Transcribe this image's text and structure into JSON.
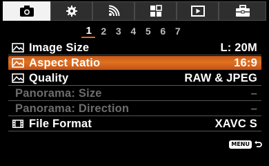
{
  "tabs": [
    {
      "icon": "camera-icon",
      "active": true
    },
    {
      "icon": "gear-icon",
      "active": false
    },
    {
      "icon": "wireless-icon",
      "active": false
    },
    {
      "icon": "grid-icon",
      "active": false
    },
    {
      "icon": "playback-icon",
      "active": false
    },
    {
      "icon": "toolbox-icon",
      "active": false
    }
  ],
  "pages": [
    "1",
    "2",
    "3",
    "4",
    "5",
    "6",
    "7"
  ],
  "active_page": "1",
  "menu_items": [
    {
      "label": "Image Size",
      "value": "L: 20M",
      "icon": "image-icon"
    },
    {
      "label": "Aspect Ratio",
      "value": "16:9",
      "icon": "image-icon",
      "selected": true
    },
    {
      "label": "Quality",
      "value": "RAW & JPEG",
      "icon": "image-icon"
    },
    {
      "label": "Panorama: Size",
      "value": "–",
      "disabled": true
    },
    {
      "label": "Panorama: Direction",
      "value": "–",
      "disabled": true
    },
    {
      "label": "File Format",
      "value": "XAVC S",
      "icon": "film-icon"
    }
  ],
  "footer": {
    "menu_label": "MENU"
  },
  "colors": {
    "accent": "#e0652b",
    "selected_row": "#d4661e"
  }
}
